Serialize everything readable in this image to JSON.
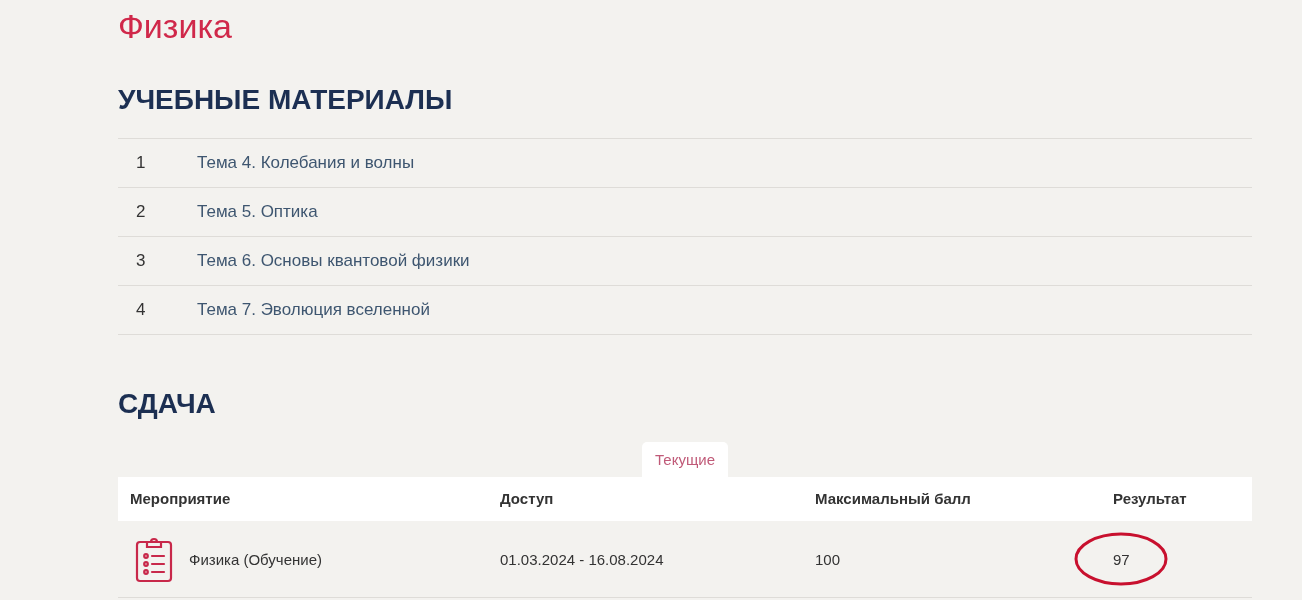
{
  "page": {
    "title": "Физика"
  },
  "materials": {
    "heading": "УЧЕБНЫЕ МАТЕРИАЛЫ",
    "items": [
      {
        "number": "1",
        "title": "Тема 4. Колебания и волны"
      },
      {
        "number": "2",
        "title": "Тема 5. Оптика"
      },
      {
        "number": "3",
        "title": "Тема 6. Основы квантовой физики"
      },
      {
        "number": "4",
        "title": "Тема 7. Эволюция вселенной"
      }
    ]
  },
  "submission": {
    "heading": "СДАЧА",
    "tabs": [
      {
        "label": "Текущие",
        "selected": true
      }
    ],
    "table": {
      "columns": [
        "Мероприятие",
        "Доступ",
        "Максимальный балл",
        "Результат"
      ],
      "rows": [
        {
          "event": "Физика (Обучение)",
          "access": "01.03.2024 - 16.08.2024",
          "max_score": "100",
          "result": "97",
          "result_circled": true
        }
      ]
    }
  }
}
